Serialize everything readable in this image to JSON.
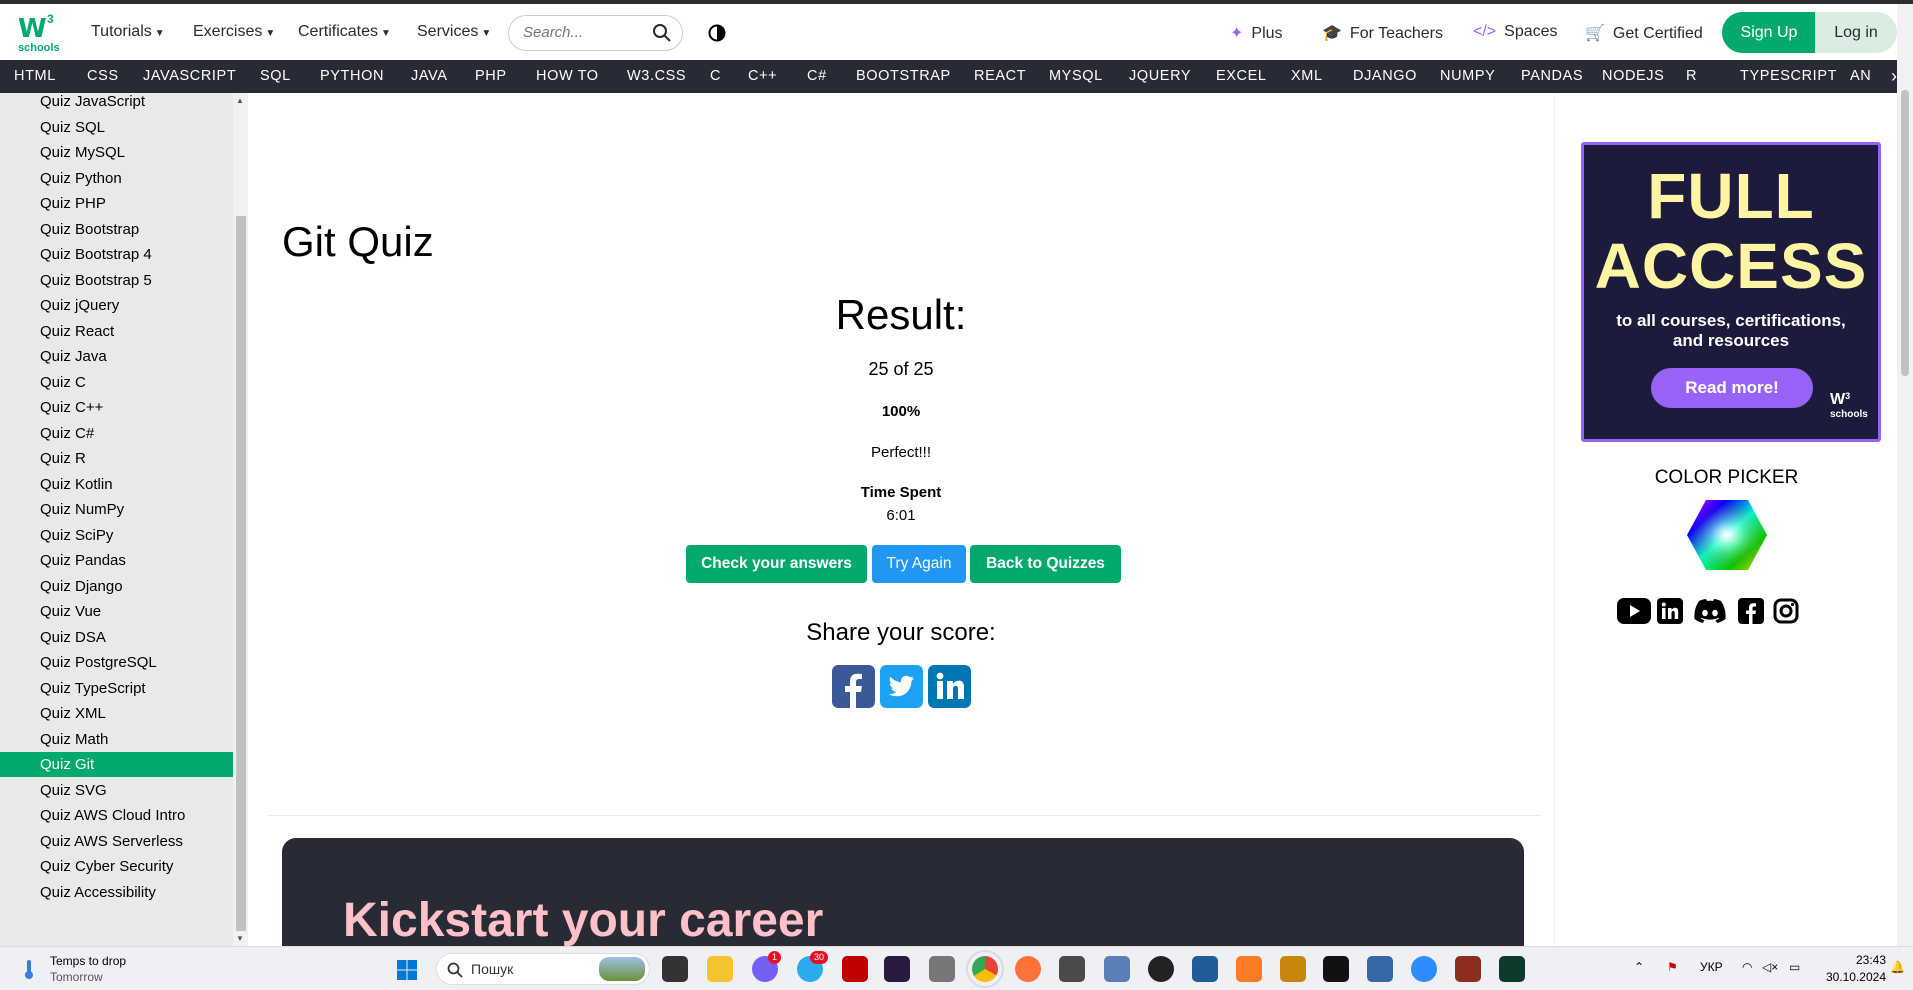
{
  "header": {
    "logo_sup": "3",
    "logo_text": "schools",
    "menus": [
      "Tutorials",
      "Exercises",
      "Certificates",
      "Services"
    ],
    "search_placeholder": "Search...",
    "right_links": [
      "Plus",
      "For Teachers",
      "Spaces",
      "Get Certified"
    ],
    "signup": "Sign Up",
    "login": "Log in"
  },
  "subnav": [
    "HTML",
    "CSS",
    "JAVASCRIPT",
    "SQL",
    "PYTHON",
    "JAVA",
    "PHP",
    "HOW TO",
    "W3.CSS",
    "C",
    "C++",
    "C#",
    "BOOTSTRAP",
    "REACT",
    "MYSQL",
    "JQUERY",
    "EXCEL",
    "XML",
    "DJANGO",
    "NUMPY",
    "PANDAS",
    "NODEJS",
    "R",
    "TYPESCRIPT",
    "AN"
  ],
  "sidebar": {
    "items": [
      "Quiz JavaScript",
      "Quiz SQL",
      "Quiz MySQL",
      "Quiz Python",
      "Quiz PHP",
      "Quiz Bootstrap",
      "Quiz Bootstrap 4",
      "Quiz Bootstrap 5",
      "Quiz jQuery",
      "Quiz React",
      "Quiz Java",
      "Quiz C",
      "Quiz C++",
      "Quiz C#",
      "Quiz R",
      "Quiz Kotlin",
      "Quiz NumPy",
      "Quiz SciPy",
      "Quiz Pandas",
      "Quiz Django",
      "Quiz Vue",
      "Quiz DSA",
      "Quiz PostgreSQL",
      "Quiz TypeScript",
      "Quiz XML",
      "Quiz Math",
      "Quiz Git",
      "Quiz SVG",
      "Quiz AWS Cloud Intro",
      "Quiz AWS Serverless",
      "Quiz Cyber Security",
      "Quiz Accessibility"
    ],
    "active": "Quiz Git"
  },
  "main": {
    "title": "Git Quiz",
    "result_label": "Result:",
    "score": "25 of 25",
    "percent": "100%",
    "verdict": "Perfect!!!",
    "time_label": "Time Spent",
    "time_value": "6:01",
    "buttons": {
      "check": "Check your answers",
      "try": "Try Again",
      "back": "Back to Quizzes"
    },
    "share_title": "Share your score:",
    "career_heading": "Kickstart your career"
  },
  "ad": {
    "line1": "FULL",
    "line2": "ACCESS",
    "sub1": "to all courses, certifications,",
    "sub2": "and resources",
    "cta": "Read more!",
    "brand_sup": "3",
    "brand": "schools"
  },
  "color_picker_title": "COLOR PICKER",
  "taskbar": {
    "weather_line1": "Temps to drop",
    "weather_line2": "Tomorrow",
    "search_placeholder": "Пошук",
    "badge_viber": "1",
    "badge_telegram": "30",
    "lang": "УКР",
    "time": "23:43",
    "date": "30.10.2024"
  },
  "colors": {
    "accent": "#04AA6D",
    "dark": "#282a35",
    "purple": "#9763f6",
    "blue": "#2196F3"
  }
}
